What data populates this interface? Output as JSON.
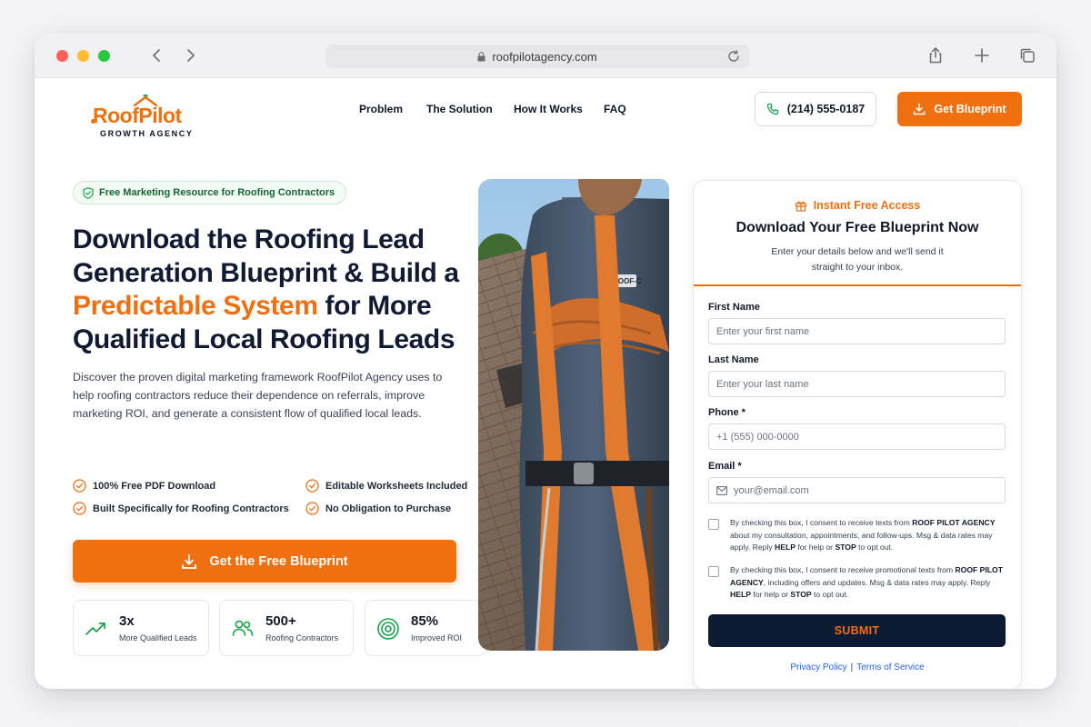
{
  "browser": {
    "url": "roofpilotagency.com"
  },
  "brand": {
    "name_part1": "Roof",
    "name_part2": "Pilot",
    "tagline": "GROWTH AGENCY",
    "accent_color": "#f07010",
    "navy_color": "#0c1a33"
  },
  "nav": {
    "items": [
      {
        "label": "Problem"
      },
      {
        "label": "The Solution"
      },
      {
        "label": "How It Works"
      },
      {
        "label": "FAQ"
      }
    ],
    "phone": "(214) 555-0187",
    "cta": "Get Blueprint"
  },
  "hero": {
    "badge": "Free Marketing Resource for Roofing Contractors",
    "headline_1": "Download the Roofing Lead Generation Blueprint & Build a ",
    "headline_accent": "Predictable System",
    "headline_2": " for More Qualified Local Roofing Leads",
    "lead": "Discover the proven digital marketing framework RoofPilot Agency uses to help roofing contractors reduce their dependence on referrals, improve marketing ROI, and generate a consistent flow of qualified local leads.",
    "features": [
      {
        "label": "100% Free PDF Download"
      },
      {
        "label": "Editable Worksheets Included"
      },
      {
        "label": "Built Specifically for Roofing Contractors"
      },
      {
        "label": "No Obligation to Purchase"
      }
    ],
    "cta": "Get the Free Blueprint",
    "stats": [
      {
        "value": "3x",
        "label": "More Qualified Leads",
        "icon": "trending-up-icon"
      },
      {
        "value": "500+",
        "label": "Roofing Contractors",
        "icon": "users-icon"
      },
      {
        "value": "85%",
        "label": "Improved ROI",
        "icon": "target-icon"
      }
    ],
    "photo_badge": "ROOF-C"
  },
  "form": {
    "kicker": "Instant Free Access",
    "title": "Download Your Free Blueprint Now",
    "description": "Enter your details below and we'll send it straight to your inbox.",
    "first_name": {
      "label": "First Name",
      "placeholder": "Enter your first name"
    },
    "last_name": {
      "label": "Last Name",
      "placeholder": "Enter your last name"
    },
    "phone": {
      "label": "Phone *",
      "placeholder": "+1 (555) 000-0000"
    },
    "email": {
      "label": "Email *",
      "placeholder": "your@email.com"
    },
    "consent_1": {
      "pre": "By checking this box, I consent to receive texts from ",
      "company": "ROOF PILOT AGENCY",
      "mid": " about my consultation, appointments, and follow-ups. Msg & data rates may apply. Reply ",
      "help": "HELP",
      "mid2": " for help or ",
      "stop": "STOP",
      "end": " to opt out."
    },
    "consent_2": {
      "pre": "By checking this box, I consent to receive promotional texts from ",
      "company": "ROOF PILOT AGENCY",
      "mid": ", including offers and updates. Msg & data rates may apply. Reply ",
      "help": "HELP",
      "mid2": " for help or ",
      "stop": "STOP",
      "end": " to opt out."
    },
    "submit": "SUBMIT",
    "privacy": "Privacy Policy",
    "separator": "|",
    "terms": "Terms of Service"
  }
}
